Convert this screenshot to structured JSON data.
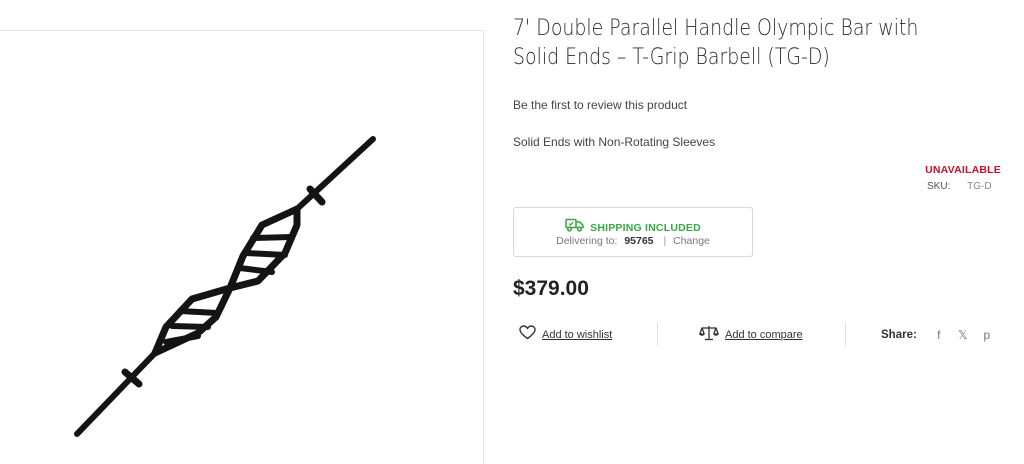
{
  "product": {
    "title_line1": "7' Double Parallel Handle Olympic Bar with",
    "title_line2": "Solid Ends – T-Grip Barbell (TG-D)",
    "review_link": "Be the first to review this product",
    "short_description": "Solid Ends with Non-Rotating Sleeves",
    "stock_status": "UNAVAILABLE",
    "sku_label": "SKU:",
    "sku_value": "TG-D",
    "price": "$379.00",
    "image_icon": "double-parallel-handle-bar-image"
  },
  "shipping": {
    "icon": "delivery-truck-icon",
    "label": "SHIPPING INCLUDED",
    "delivering_to_label": "Delivering to:",
    "zip": "95765",
    "separator": "|",
    "change_label": "Change",
    "accent_color": "#3aa845"
  },
  "actions": {
    "wishlist_label": "Add to wishlist",
    "compare_label": "Add to compare",
    "share_label": "Share:",
    "social": [
      {
        "name": "facebook-icon",
        "glyph": "f"
      },
      {
        "name": "x-icon",
        "glyph": "𝕏"
      },
      {
        "name": "pinterest-icon",
        "glyph": "p"
      }
    ]
  },
  "colors": {
    "unavailable": "#c4112f",
    "text": "#222222"
  }
}
